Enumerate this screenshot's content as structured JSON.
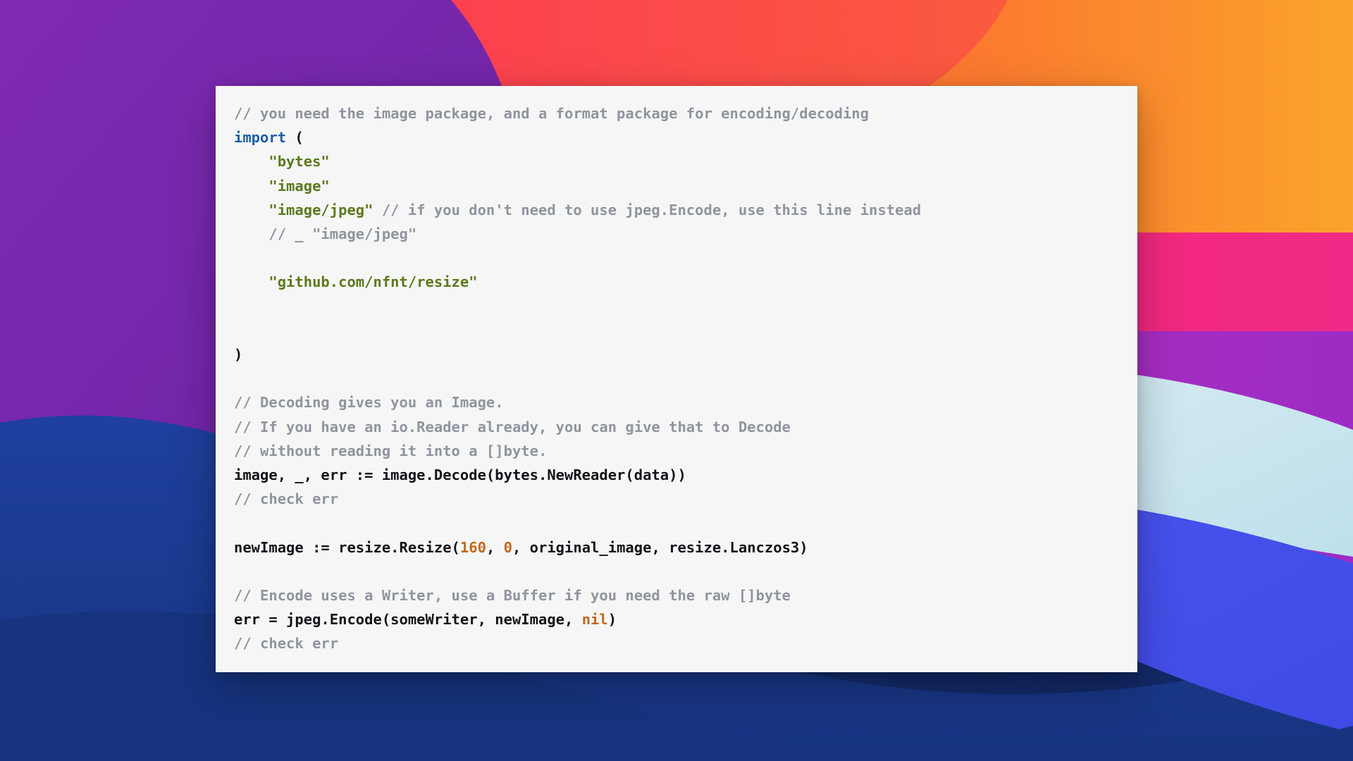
{
  "wallpaper": {
    "description": "layered-wave-gradient-wallpaper",
    "colors": {
      "deep_blue": "#16347f",
      "royal_blue": "#1e3f9e",
      "indigo_blue": "#4550e8",
      "purple": "#7a28ab",
      "magenta": "#b02ec0",
      "pink": "#f4257a",
      "red": "#fb3b53",
      "orange": "#fb6a33",
      "amber": "#fba02b",
      "pale_blue": "#c9e5ef"
    }
  },
  "card": {
    "name": "code-snippet-card",
    "background": "#f6f6f7",
    "language": "go"
  },
  "code": {
    "lines": [
      [
        {
          "t": "// you need the image package, and a format package for encoding/decoding",
          "c": "tok-comment"
        }
      ],
      [
        {
          "t": "import",
          "c": "tok-keyword"
        },
        {
          "t": " ",
          "c": "tok-plain"
        },
        {
          "t": "(",
          "c": "tok-punct"
        }
      ],
      [
        {
          "t": "    ",
          "c": "tok-plain"
        },
        {
          "t": "\"bytes\"",
          "c": "tok-string"
        }
      ],
      [
        {
          "t": "    ",
          "c": "tok-plain"
        },
        {
          "t": "\"image\"",
          "c": "tok-string"
        }
      ],
      [
        {
          "t": "    ",
          "c": "tok-plain"
        },
        {
          "t": "\"image/jpeg\"",
          "c": "tok-string"
        },
        {
          "t": " ",
          "c": "tok-plain"
        },
        {
          "t": "// if you don't need to use jpeg.Encode, use this line instead",
          "c": "tok-comment"
        }
      ],
      [
        {
          "t": "    ",
          "c": "tok-plain"
        },
        {
          "t": "// _ \"image/jpeg\"",
          "c": "tok-comment"
        }
      ],
      [],
      [
        {
          "t": "    ",
          "c": "tok-plain"
        },
        {
          "t": "\"github.com/nfnt/resize\"",
          "c": "tok-string"
        }
      ],
      [],
      [],
      [
        {
          "t": ")",
          "c": "tok-punct"
        }
      ],
      [],
      [
        {
          "t": "// Decoding gives you an Image.",
          "c": "tok-comment"
        }
      ],
      [
        {
          "t": "// If you have an io.Reader already, you can give that to Decode",
          "c": "tok-comment"
        }
      ],
      [
        {
          "t": "// without reading it into a []byte.",
          "c": "tok-comment"
        }
      ],
      [
        {
          "t": "image, _, err := image.Decode(bytes.NewReader(data))",
          "c": "tok-plain"
        }
      ],
      [
        {
          "t": "// check err",
          "c": "tok-comment"
        }
      ],
      [],
      [
        {
          "t": "newImage := resize.Resize(",
          "c": "tok-plain"
        },
        {
          "t": "160",
          "c": "tok-number"
        },
        {
          "t": ", ",
          "c": "tok-plain"
        },
        {
          "t": "0",
          "c": "tok-number"
        },
        {
          "t": ", original_image, resize.Lanczos3)",
          "c": "tok-plain"
        }
      ],
      [],
      [
        {
          "t": "// Encode uses a Writer, use a Buffer if you need the raw []byte",
          "c": "tok-comment"
        }
      ],
      [
        {
          "t": "err = jpeg.Encode(someWriter, newImage, ",
          "c": "tok-plain"
        },
        {
          "t": "nil",
          "c": "tok-const"
        },
        {
          "t": ")",
          "c": "tok-plain"
        }
      ],
      [
        {
          "t": "// check err",
          "c": "tok-comment"
        }
      ]
    ]
  }
}
